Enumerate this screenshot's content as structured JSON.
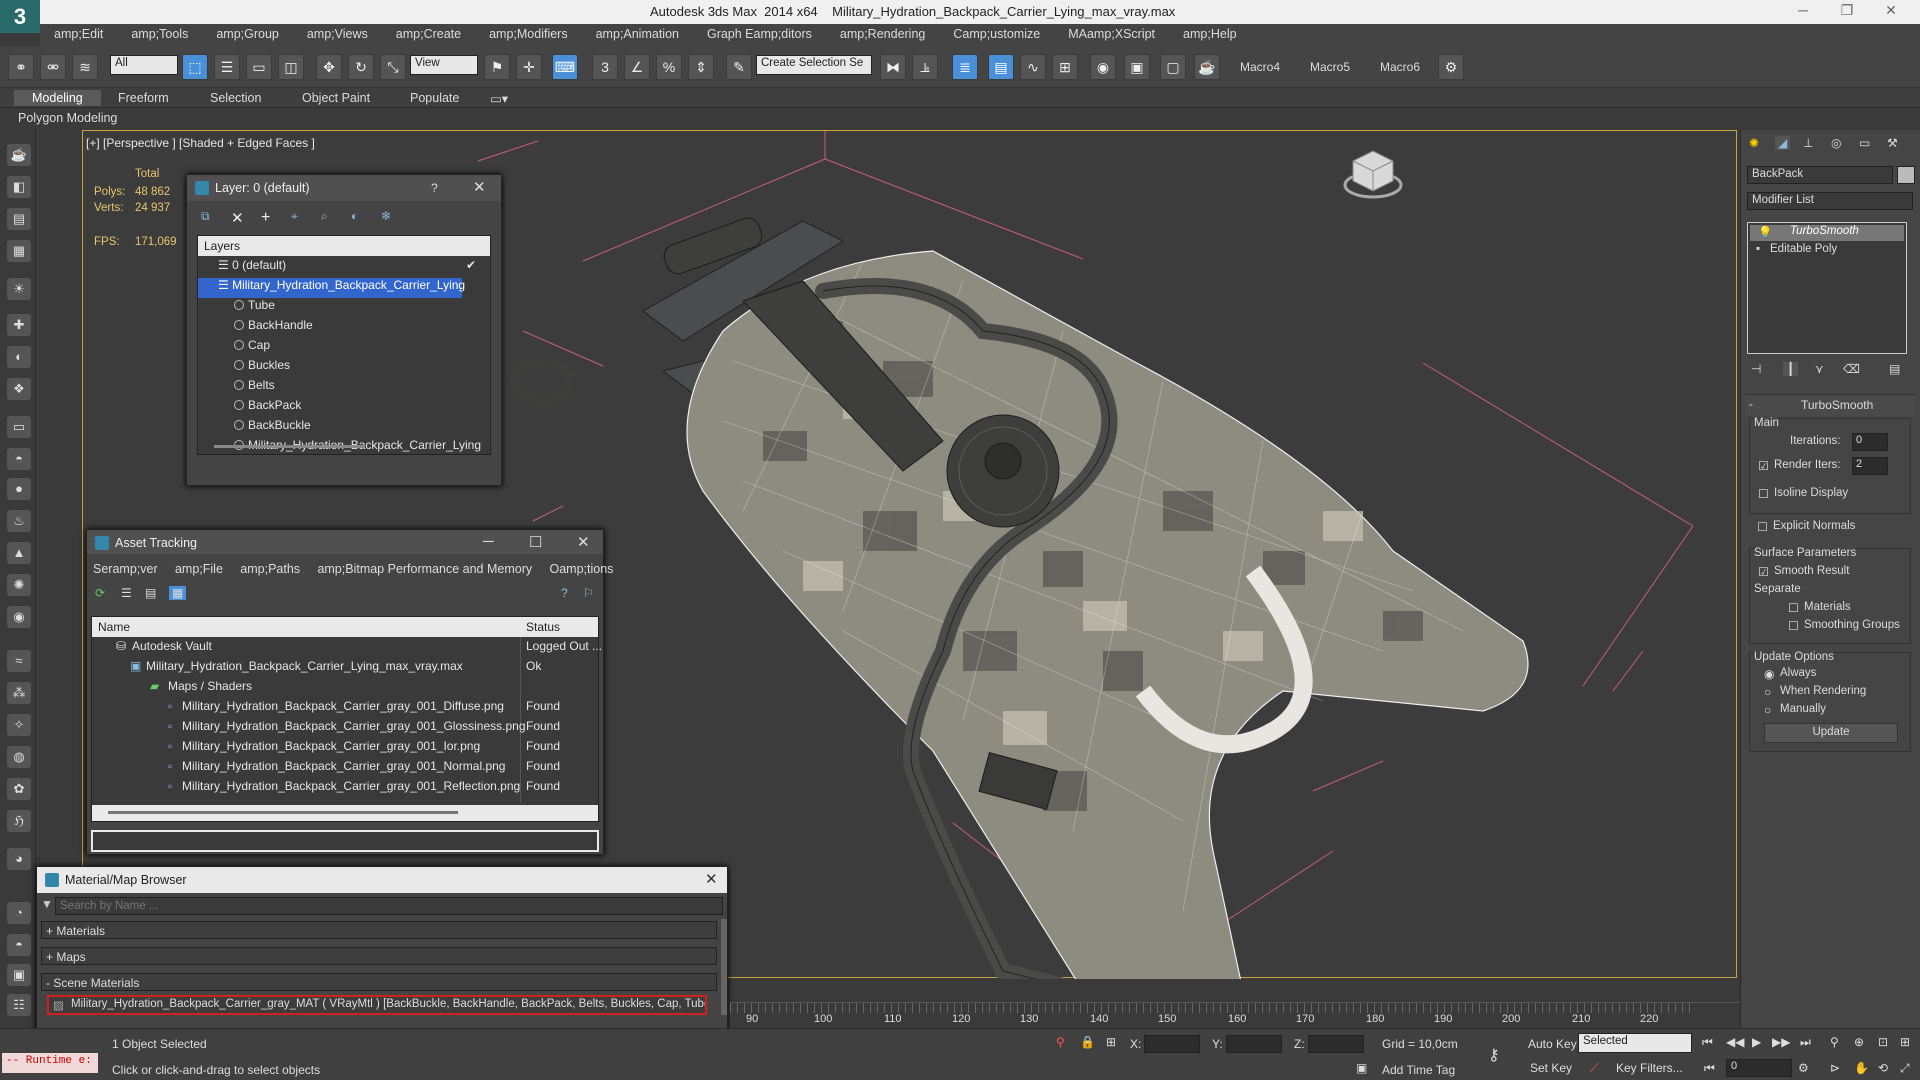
{
  "title": {
    "app": "Autodesk 3ds Max  2014 x64",
    "file": "Military_Hydration_Backpack_Carrier_Lying_max_vray.max"
  },
  "menu": [
    "amp;Edit",
    "amp;Tools",
    "amp;Group",
    "amp;Views",
    "amp;Create",
    "amp;Modifiers",
    "amp;Animation",
    "Graph Eamp;ditors",
    "amp;Rendering",
    "Camp;ustomize",
    "MAamp;XScript",
    "amp;Help"
  ],
  "toolbar": {
    "filter": "All",
    "view": "View",
    "selection_set": "Create Selection Se",
    "macros": [
      "Macro4",
      "Macro5",
      "Macro6"
    ]
  },
  "ribbon": {
    "tabs": [
      "Modeling",
      "Freeform",
      "Selection",
      "Object Paint",
      "Populate"
    ],
    "sub": "Polygon Modeling"
  },
  "viewport": {
    "label": "[+] [Perspective ] [Shaded + Edged Faces ]",
    "total": "Total",
    "polys_label": "Polys:",
    "polys": "48 862",
    "verts_label": "Verts:",
    "verts": "24 937",
    "fps_label": "FPS:",
    "fps": "171,069"
  },
  "layer_win": {
    "title": "Layer: 0 (default)",
    "help": "?",
    "header": "Layers",
    "rows": [
      "0 (default)",
      "Military_Hydration_Backpack_Carrier_Lying",
      "Tube",
      "BackHandle",
      "Cap",
      "Buckles",
      "Belts",
      "BackPack",
      "BackBuckle",
      "Military_Hydration_Backpack_Carrier_Lying"
    ]
  },
  "asset_win": {
    "title": "Asset Tracking",
    "menu": [
      "Seramp;ver",
      "amp;File",
      "amp;Paths",
      "amp;Bitmap Performance and Memory",
      "Oamp;tions"
    ],
    "col_name": "Name",
    "col_status": "Status",
    "rows": [
      {
        "name": "Autodesk Vault",
        "status": "Logged Out ..."
      },
      {
        "name": "Military_Hydration_Backpack_Carrier_Lying_max_vray.max",
        "status": "Ok"
      },
      {
        "name": "Maps / Shaders",
        "status": ""
      },
      {
        "name": "Military_Hydration_Backpack_Carrier_gray_001_Diffuse.png",
        "status": "Found"
      },
      {
        "name": "Military_Hydration_Backpack_Carrier_gray_001_Glossiness.png",
        "status": "Found"
      },
      {
        "name": "Military_Hydration_Backpack_Carrier_gray_001_Ior.png",
        "status": "Found"
      },
      {
        "name": "Military_Hydration_Backpack_Carrier_gray_001_Normal.png",
        "status": "Found"
      },
      {
        "name": "Military_Hydration_Backpack_Carrier_gray_001_Reflection.png",
        "status": "Found"
      }
    ]
  },
  "mat_win": {
    "title": "Material/Map Browser",
    "search": "Search by Name ...",
    "materials": "+ Materials",
    "maps": "+ Maps",
    "scene": "- Scene Materials",
    "scene_item": "Military_Hydration_Backpack_Carrier_gray_MAT  ( VRayMtl )  [BackBuckle, BackHandle, BackPack, Belts, Buckles, Cap, Tube]"
  },
  "cmd": {
    "object": "BackPack",
    "modifier_list": "Modifier List",
    "stack": [
      "TurboSmooth",
      "Editable Poly"
    ],
    "rollout": "TurboSmooth",
    "main": "Main",
    "iterations_label": "Iterations:",
    "iterations": "0",
    "render_iters_label": "Render Iters:",
    "render_iters": "2",
    "isoline": "Isoline Display",
    "explicit": "Explicit Normals",
    "surface": "Surface Parameters",
    "smooth": "Smooth Result",
    "separate": "Separate",
    "materials": "Materials",
    "smoothing": "Smoothing Groups",
    "update_opts": "Update Options",
    "always": "Always",
    "when_render": "When Rendering",
    "manually": "Manually",
    "update": "Update"
  },
  "timeline": {
    "ticks": [
      "90",
      "100",
      "110",
      "120",
      "130",
      "140",
      "150",
      "160",
      "170",
      "180",
      "190",
      "200",
      "210",
      "220"
    ]
  },
  "status": {
    "script": "-- Runtime e:",
    "selected": "1 Object Selected",
    "hint": "Click or click-and-drag to select objects",
    "x": "X:",
    "y": "Y:",
    "z": "Z:",
    "grid": "Grid = 10,0cm",
    "add_time_tag": "Add Time Tag",
    "auto_key": "Auto Key",
    "set_key": "Set Key",
    "selected_mode": "Selected",
    "key_filters": "Key Filters...",
    "frame": "0"
  },
  "colors": {
    "accent": "#4a90d9",
    "viewport_border": "#c8a23a",
    "selection": "#3366cc"
  }
}
